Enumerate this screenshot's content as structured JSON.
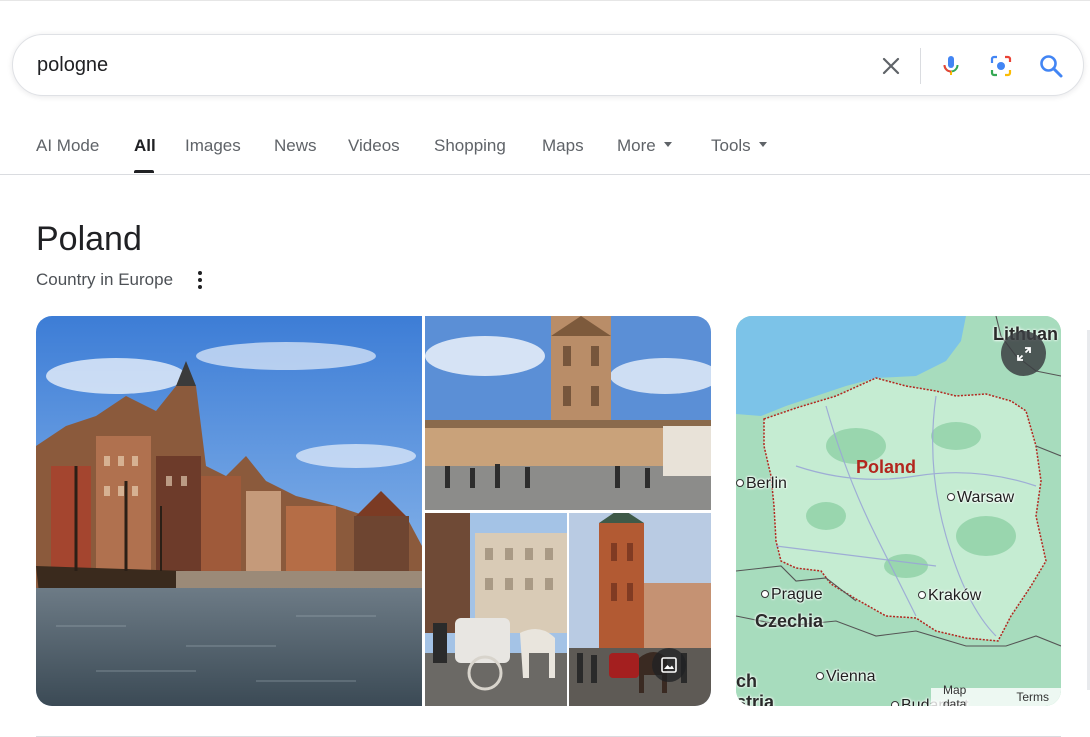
{
  "search": {
    "query": "pologne",
    "icons": [
      "close-icon",
      "microphone-icon",
      "lens-icon",
      "search-icon"
    ]
  },
  "tabs": [
    {
      "label": "AI Mode",
      "active": false
    },
    {
      "label": "All",
      "active": true
    },
    {
      "label": "Images",
      "active": false
    },
    {
      "label": "News",
      "active": false
    },
    {
      "label": "Videos",
      "active": false
    },
    {
      "label": "Shopping",
      "active": false
    },
    {
      "label": "Maps",
      "active": false
    },
    {
      "label": "More",
      "active": false,
      "dropdown": true
    },
    {
      "label": "Tools",
      "active": false,
      "dropdown": true
    }
  ],
  "knowledge_panel": {
    "title": "Poland",
    "subtitle": "Country in Europe"
  },
  "map": {
    "country_label": "Poland",
    "cities": [
      "Berlin",
      "Warsaw",
      "Prague",
      "Kraków",
      "Vienna"
    ],
    "countries": [
      "Lithuan",
      "Czechia",
      "ch",
      "stria"
    ],
    "partial_label": "Budapest",
    "attribution": {
      "map_data": "Map data",
      "terms": "Terms"
    }
  },
  "colors": {
    "accent_text": "#202124",
    "muted_text": "#5f6368",
    "poland_border": "#b3261e",
    "map_land": "#9ed8b6",
    "map_water": "#7cc3e8"
  }
}
